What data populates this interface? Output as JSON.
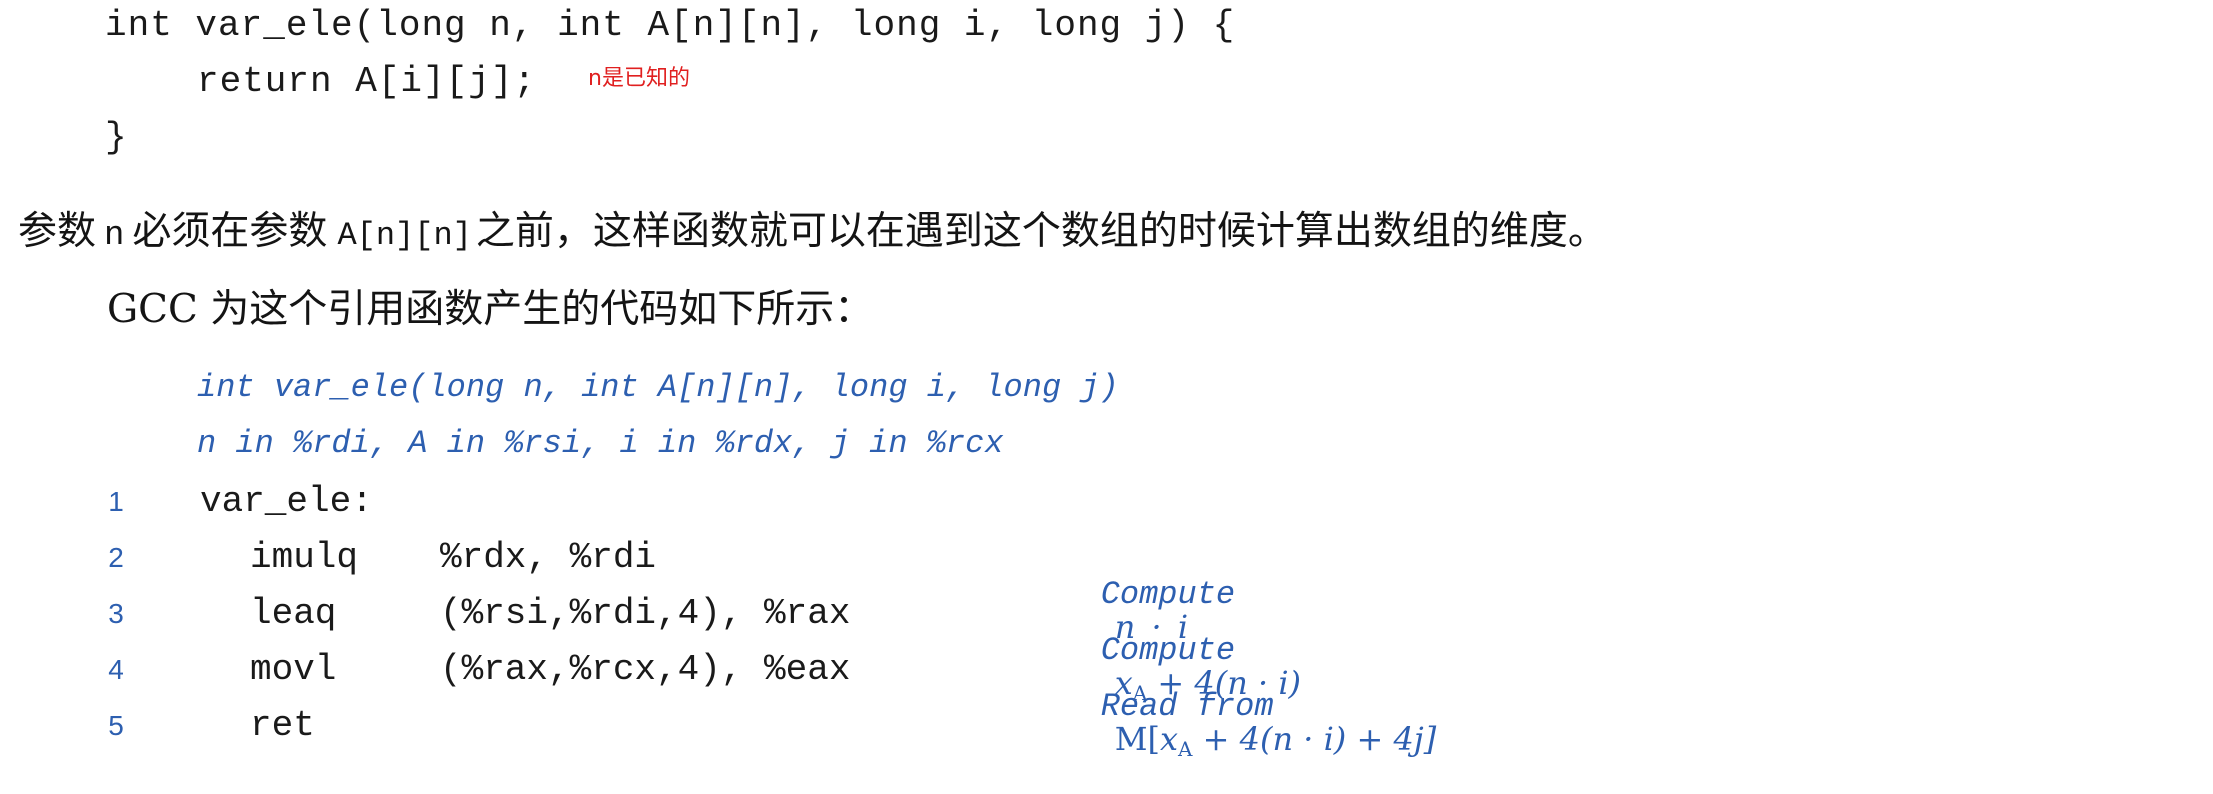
{
  "c_code": {
    "line1": "int var_ele(long n, int A[n][n], long i, long j) {",
    "line2": "return A[i][j];",
    "line3": "}",
    "annotation": "n是已知的"
  },
  "paragraphs": {
    "p1_prefix": "参数",
    "p1_n": "n",
    "p1_mid": "必须在参数",
    "p1_array": "A[n][n]",
    "p1_suffix": "之前，这样函数就可以在遇到这个数组的时候计算出数组的维度。",
    "p2": "GCC 为这个引用函数产生的代码如下所示："
  },
  "assembly": {
    "header1": "int var_ele(long n, int A[n][n], long i, long j)",
    "header2": "n in %rdi, A in %rsi, i in %rdx, j in %rcx",
    "lines": [
      {
        "num": "1",
        "instr": "var_ele:",
        "operands": ""
      },
      {
        "num": "2",
        "instr": "imulq",
        "operands": "%rdx, %rdi"
      },
      {
        "num": "3",
        "instr": "leaq",
        "operands": "(%rsi,%rdi,4), %rax"
      },
      {
        "num": "4",
        "instr": "movl",
        "operands": "(%rax,%rcx,4), %eax"
      },
      {
        "num": "5",
        "instr": "ret",
        "operands": ""
      }
    ],
    "comments": {
      "c2_label": "Compute",
      "c2_expr": "n · i",
      "c3_label": "Compute",
      "c3_x": "x",
      "c3_sub": "A",
      "c3_rest": " + 4(n · i)",
      "c4_label": "Read from",
      "c4_M": "M[",
      "c4_x": "x",
      "c4_sub": "A",
      "c4_rest": " + 4(n · i) + 4j]"
    }
  }
}
